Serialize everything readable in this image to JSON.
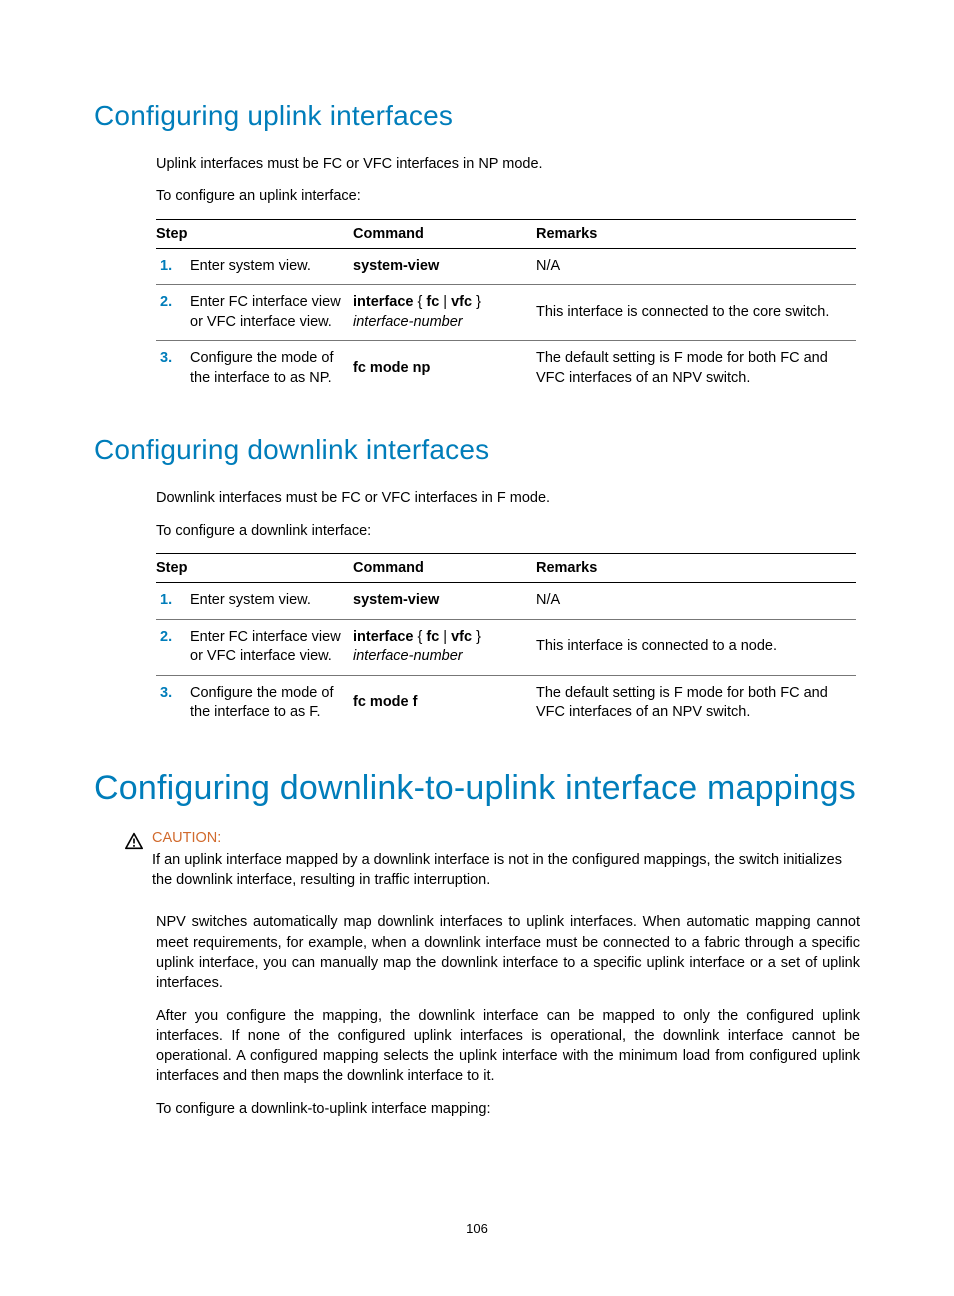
{
  "page_number": "106",
  "section1": {
    "heading": "Configuring uplink interfaces",
    "p1": "Uplink interfaces must be FC or VFC interfaces in NP mode.",
    "p2": "To configure an uplink interface:",
    "table": {
      "headers": {
        "step": "Step",
        "command": "Command",
        "remarks": "Remarks"
      },
      "rows": [
        {
          "num": "1.",
          "desc": "Enter system view.",
          "cmd_bold": "system-view",
          "cmd_italic": "",
          "remarks": "N/A"
        },
        {
          "num": "2.",
          "desc": "Enter FC interface view or VFC interface view.",
          "cmd_bold": "interface",
          "cmd_rest": " { fc | vfc }",
          "cmd_italic": "interface-number",
          "remarks": "This interface is connected to the core switch."
        },
        {
          "num": "3.",
          "desc": "Configure the mode of the interface to as NP.",
          "cmd_bold": "fc mode np",
          "cmd_italic": "",
          "remarks": "The default setting is F mode for both FC and VFC interfaces of an NPV switch."
        }
      ]
    }
  },
  "section2": {
    "heading": "Configuring downlink interfaces",
    "p1": "Downlink interfaces must be FC or VFC interfaces in F mode.",
    "p2": "To configure a downlink interface:",
    "table": {
      "headers": {
        "step": "Step",
        "command": "Command",
        "remarks": "Remarks"
      },
      "rows": [
        {
          "num": "1.",
          "desc": "Enter system view.",
          "cmd_bold": "system-view",
          "cmd_italic": "",
          "remarks": "N/A"
        },
        {
          "num": "2.",
          "desc": "Enter FC interface view or VFC interface view.",
          "cmd_bold": "interface",
          "cmd_rest": " { fc | vfc }",
          "cmd_italic": "interface-number",
          "remarks": "This interface is connected to a node."
        },
        {
          "num": "3.",
          "desc": "Configure the mode of the interface to as F.",
          "cmd_bold": "fc mode f",
          "cmd_italic": "",
          "remarks": "The default setting is F mode for both FC and VFC interfaces of an NPV switch."
        }
      ]
    }
  },
  "section3": {
    "heading": "Configuring downlink-to-uplink interface mappings",
    "caution": {
      "label": "CAUTION:",
      "body": "If an uplink interface mapped by a downlink interface is not in the configured mappings, the switch initializes the downlink interface, resulting in traffic interruption."
    },
    "p1": "NPV switches automatically map downlink interfaces to uplink interfaces. When automatic mapping cannot meet requirements, for example, when a downlink interface must be connected to a fabric through a specific uplink interface, you can manually map the downlink interface to a specific uplink interface or a set of uplink interfaces.",
    "p2": "After you configure the mapping, the downlink interface can be mapped to only the configured uplink interfaces. If none of the configured uplink interfaces is operational, the downlink interface cannot be operational. A configured mapping selects the uplink interface with the minimum load from configured uplink interfaces and then maps the downlink interface to it.",
    "p3": "To configure a downlink-to-uplink interface mapping:"
  },
  "cmd_parts": {
    "fc": "fc",
    "vfc": "vfc",
    "brace_open": " { ",
    "pipe": " | ",
    "brace_close": " }"
  }
}
